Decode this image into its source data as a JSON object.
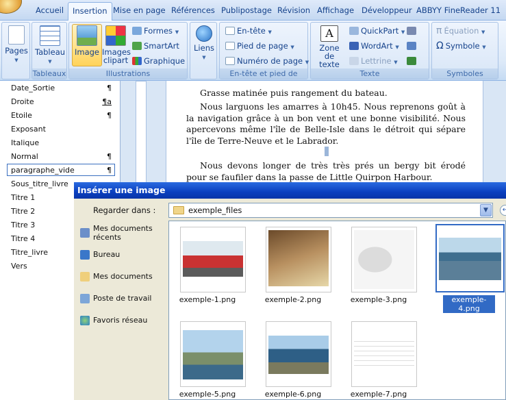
{
  "tabs": [
    "Accueil",
    "Insertion",
    "Mise en page",
    "Références",
    "Publipostage",
    "Révision",
    "Affichage",
    "Développeur",
    "ABBYY FineReader 11"
  ],
  "active_tab": "Insertion",
  "ribbon": {
    "pages": {
      "label": "Pages"
    },
    "tableaux": {
      "button": "Tableau",
      "group": "Tableaux"
    },
    "illustrations": {
      "image": "Image",
      "clipart": "Images clipart",
      "formes": "Formes",
      "smartart": "SmartArt",
      "graphique": "Graphique",
      "group": "Illustrations"
    },
    "liens": {
      "label": "Liens"
    },
    "entete": {
      "entete": "En-tête",
      "pied": "Pied de page",
      "numero": "Numéro de page",
      "group": "En-tête et pied de page"
    },
    "texte": {
      "zone": "Zone de texte",
      "quickpart": "QuickPart",
      "wordart": "WordArt",
      "lettrine": "Lettrine",
      "group": "Texte"
    },
    "symboles": {
      "equation": "Équation",
      "symbole": "Symbole",
      "group": "Symboles"
    }
  },
  "styles": [
    {
      "name": "Date_Sortie",
      "mark": "¶"
    },
    {
      "name": "Droite",
      "mark": "¶a"
    },
    {
      "name": "Etoile",
      "mark": "¶"
    },
    {
      "name": "Exposant",
      "mark": ""
    },
    {
      "name": "Italique",
      "mark": ""
    },
    {
      "name": "Normal",
      "mark": "¶"
    },
    {
      "name": "paragraphe_vide",
      "mark": "¶"
    },
    {
      "name": "Sous_titre_livre",
      "mark": ""
    },
    {
      "name": "Titre 1",
      "mark": ""
    },
    {
      "name": "Titre 2",
      "mark": ""
    },
    {
      "name": "Titre 3",
      "mark": ""
    },
    {
      "name": "Titre 4",
      "mark": ""
    },
    {
      "name": "Titre_livre",
      "mark": ""
    },
    {
      "name": "Vers",
      "mark": ""
    }
  ],
  "document": {
    "p1": "Grasse matinée puis rangement du bateau.",
    "p2": "Nous larguons les amarres à 10h45. Nous reprenons goût à la navigation grâce à un bon vent et une bonne visibilité. Nous apercevons même l'île de Belle-Isle dans le détroit qui sépare l'île de Terre-Neuve et le Labrador.",
    "p3": "Nous devons longer de très très prés un bergy bit érodé pour se faufiler dans la passe de Little Quirpon Harbour."
  },
  "dialog": {
    "title": "Insérer une image",
    "look_in_label": "Regarder dans :",
    "look_in_value": "exemple_files",
    "places": [
      "Mes documents récents",
      "Bureau",
      "Mes documents",
      "Poste de travail",
      "Favoris réseau"
    ],
    "files": [
      "exemple-1.png",
      "exemple-2.png",
      "exemple-3.png",
      "exemple-4.png",
      "exemple-5.png",
      "exemple-6.png",
      "exemple-7.png"
    ],
    "selected_file": "exemple-4.png"
  },
  "colors": {
    "title_bar": "#0a3fbf",
    "selection": "#316ac5",
    "ribbon_text": "#15428b"
  }
}
